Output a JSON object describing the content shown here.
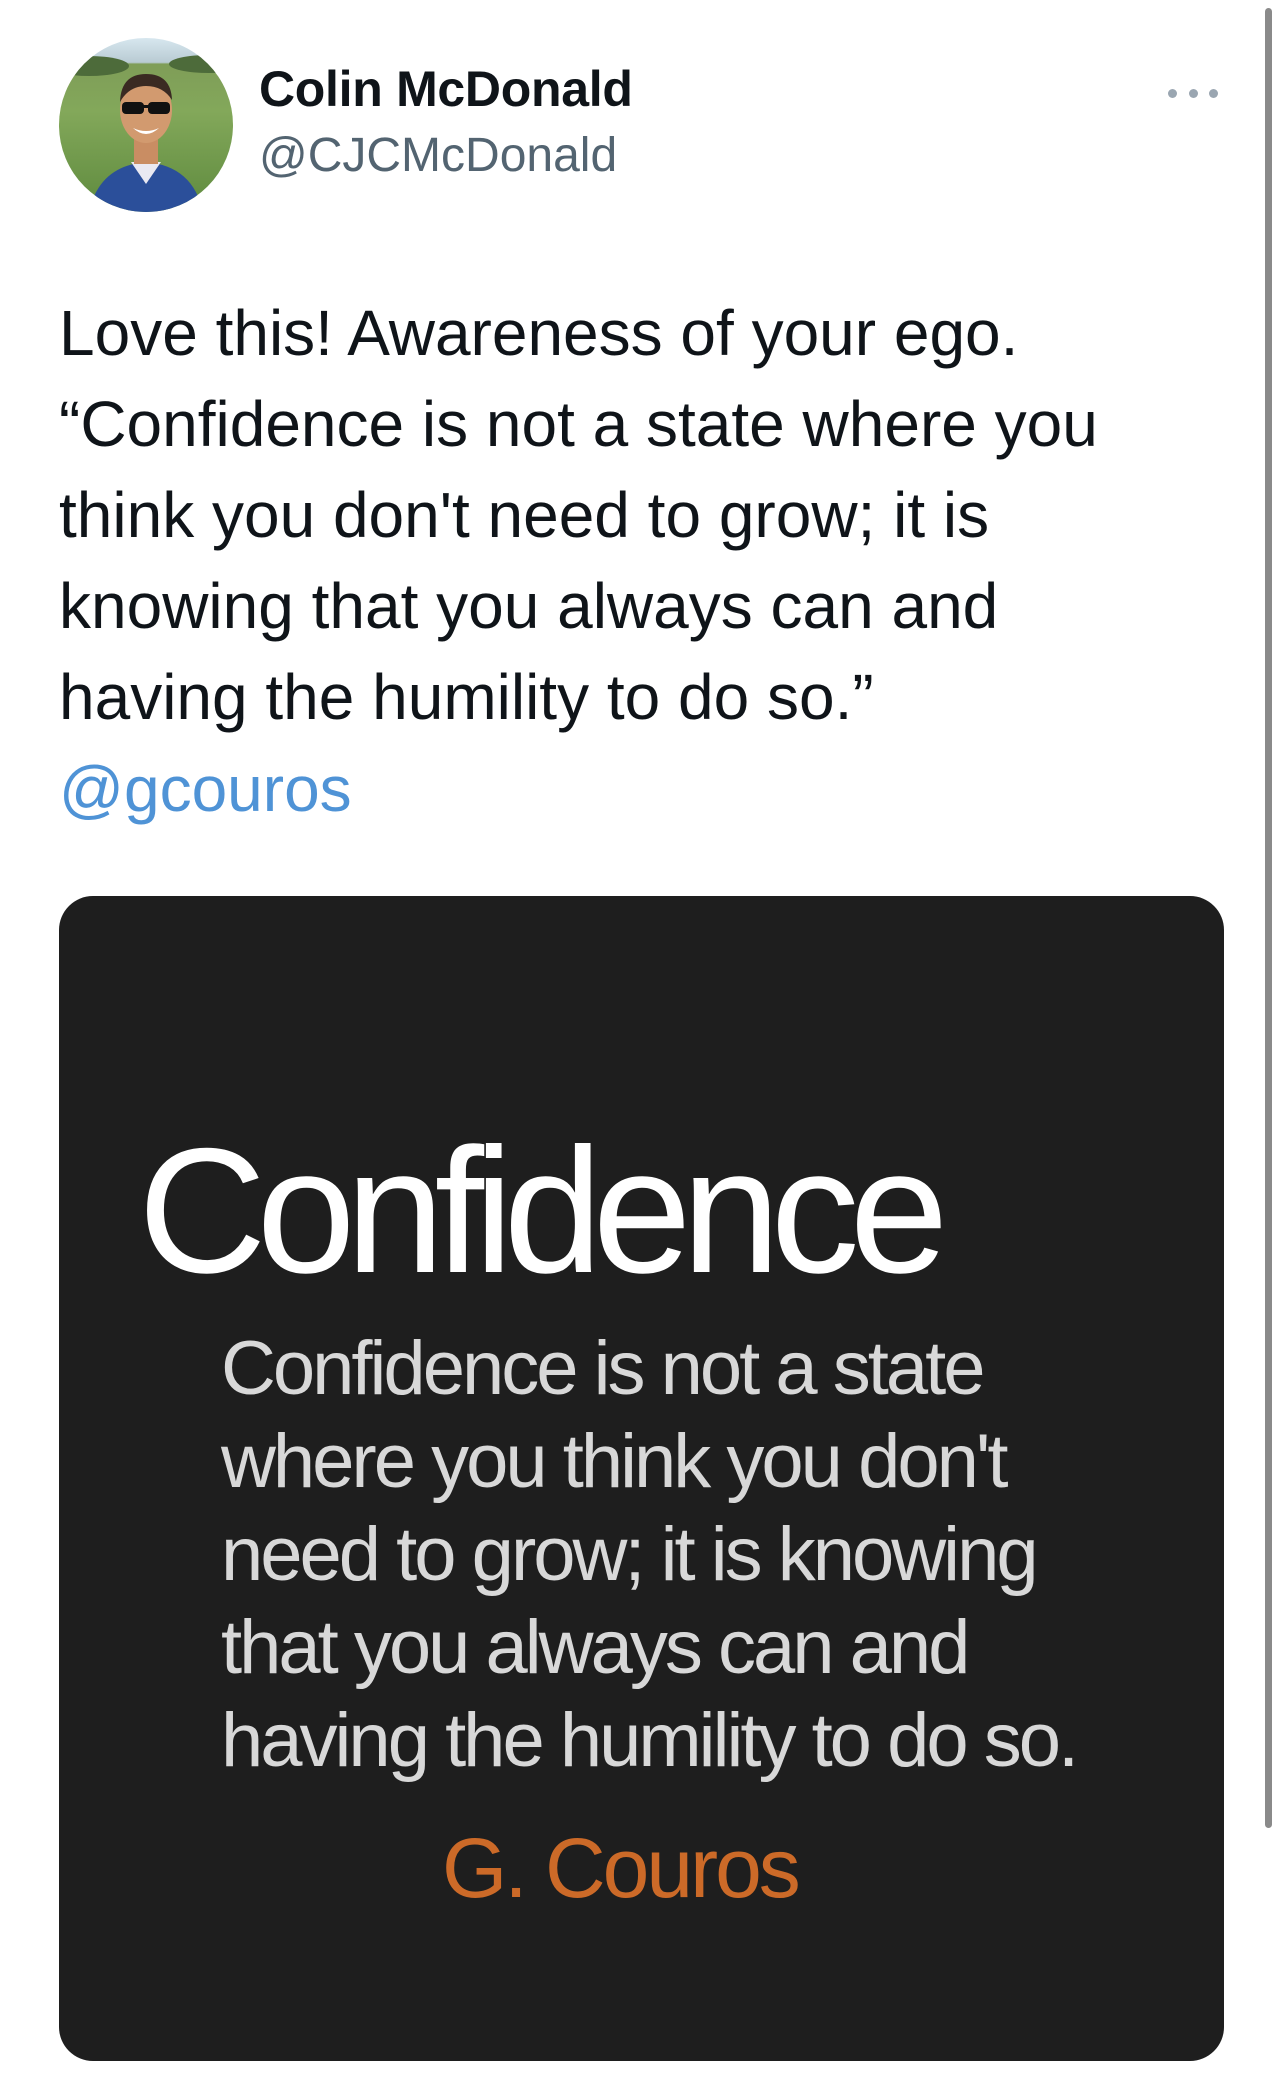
{
  "tweet": {
    "author": {
      "display_name": "Colin McDonald",
      "handle": "@CJCMcDonald"
    },
    "text_lines": [
      "Love this! Awareness of your ego.",
      "“Confidence is not a state where you",
      "think you don't need to grow; it is",
      "knowing that you always can and",
      "having the humility to do so.”"
    ],
    "mention": "@gcouros",
    "menu_icon": "more-dots-icon"
  },
  "media": {
    "title": "Confidence",
    "body_lines": [
      "Confidence is not a state",
      "where you think you don't",
      "need to grow; it is knowing",
      "that you always can and",
      "having the humility to do so."
    ],
    "author": "G. Couros"
  },
  "colors": {
    "mention": "#4f93d6",
    "card_background": "#1e1e1e",
    "quote_author": "#cc6a28",
    "handle": "#536471"
  }
}
